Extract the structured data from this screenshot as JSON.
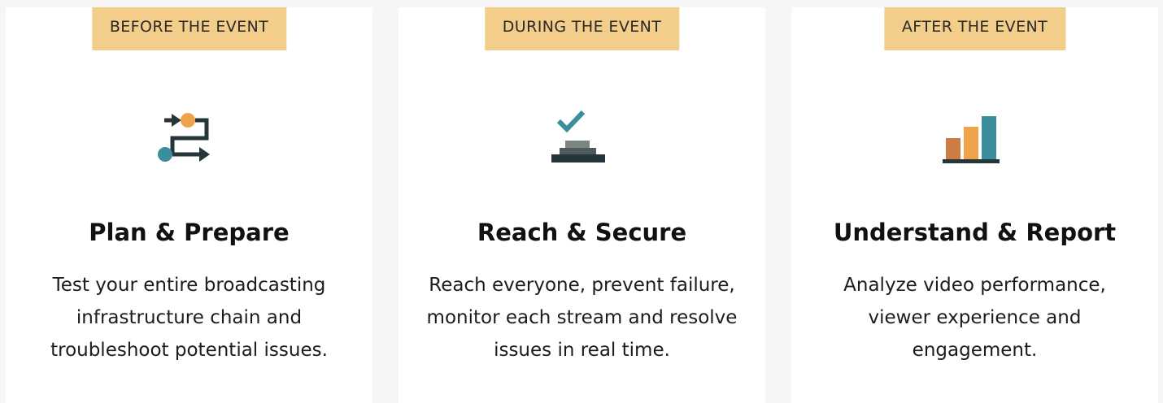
{
  "colors": {
    "page_background": "#f6f6f6",
    "card_background": "#ffffff",
    "badge_background": "#f3cd8a",
    "dark": "#25353a",
    "orange": "#eea24a",
    "teal": "#3b8e9c",
    "brick": "#cc7d46",
    "gray": "#7a8684"
  },
  "cards": [
    {
      "badge": "BEFORE THE EVENT",
      "icon": "workflow-arrows-icon",
      "title": "Plan & Prepare",
      "description": "Test your entire broadcasting infrastructure chain and troubleshoot potential issues."
    },
    {
      "badge": "DURING THE EVENT",
      "icon": "checkmark-stack-icon",
      "title": "Reach & Secure",
      "description": "Reach everyone, prevent failure, monitor each stream and resolve issues in real time."
    },
    {
      "badge": "AFTER THE EVENT",
      "icon": "bar-chart-icon",
      "title": "Understand & Report",
      "description": "Analyze video performance, viewer experience and engagement."
    }
  ]
}
